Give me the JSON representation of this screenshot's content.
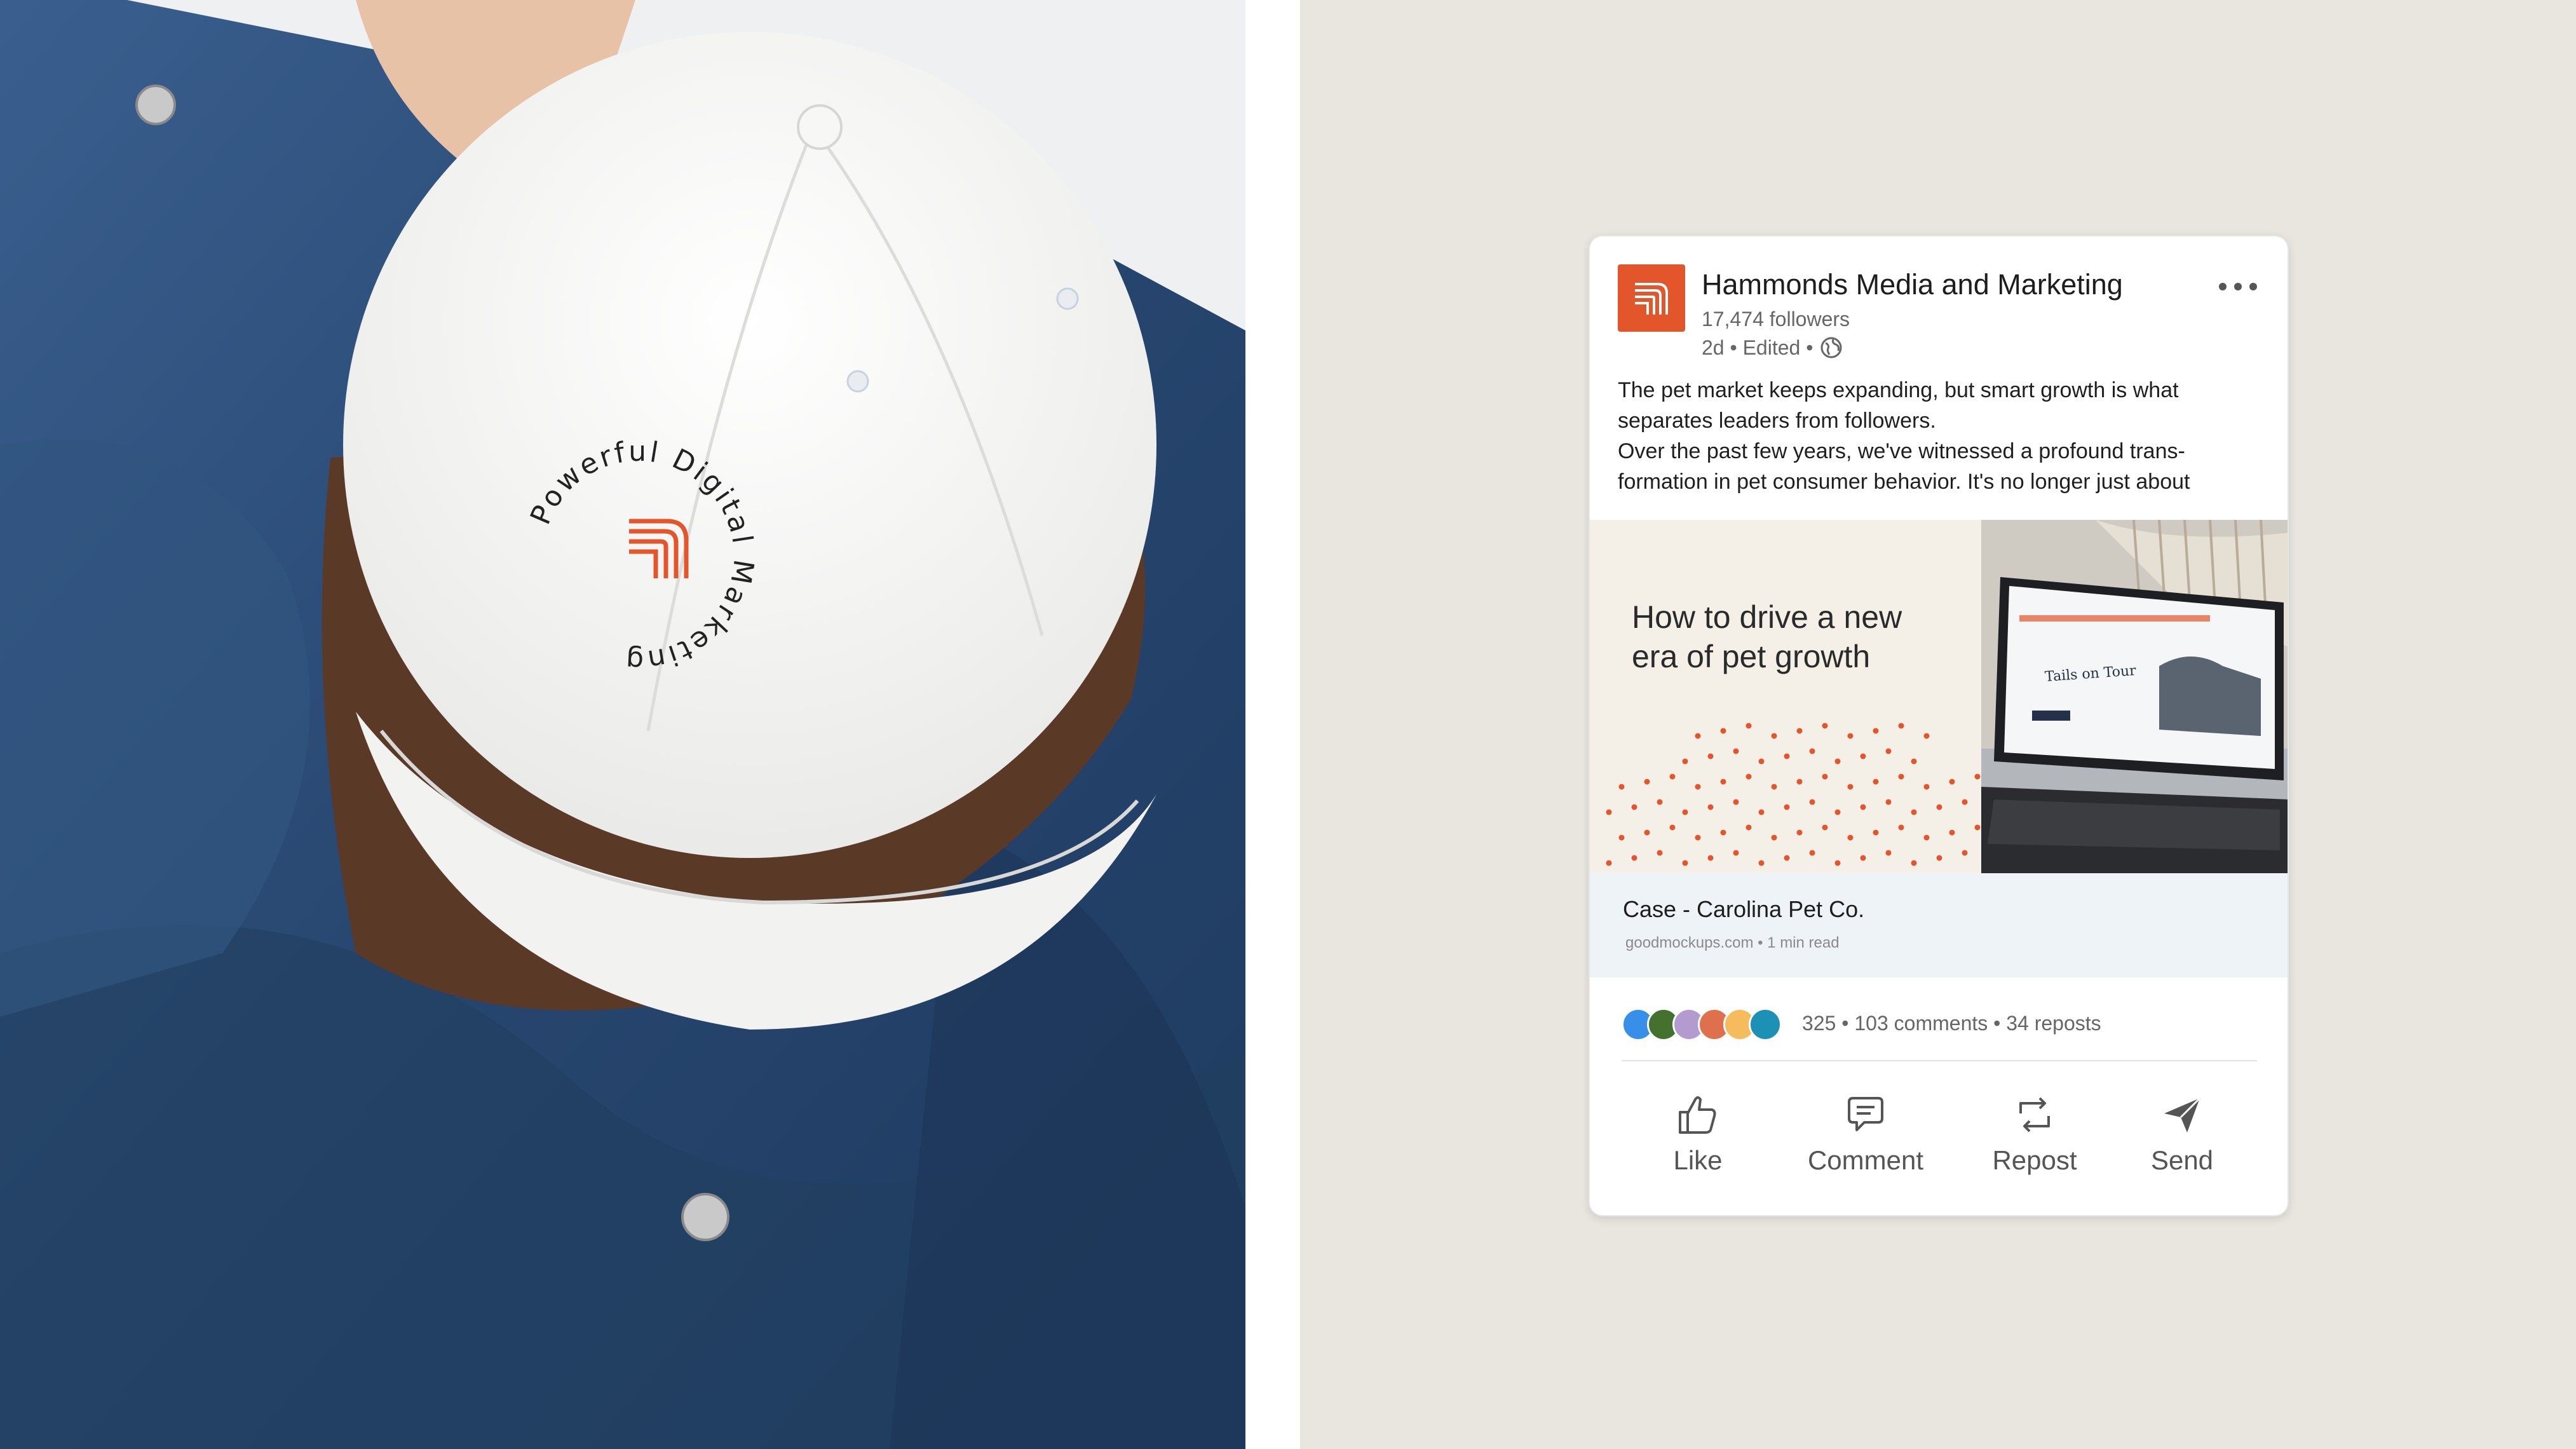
{
  "photo": {
    "cap_emblem_text": "Powerful Digital Marketing",
    "cap_icon": "stacked-arches-logo-icon"
  },
  "post": {
    "company_name": "Hammonds Media and Marketing",
    "followers": "17,474 followers",
    "meta": "2d • Edited •",
    "more_icon": "ellipsis-icon",
    "body_lines": [
      "The pet market keeps expanding, but smart growth is what",
      "separates leaders from followers.",
      "Over the past few years, we've witnessed a profound trans-",
      "formation in pet consumer behavior. It's no longer just about"
    ],
    "media": {
      "headline_line1": "How to drive a new",
      "headline_line2": "era of pet growth",
      "screen_title": "Tails on Tour"
    },
    "link": {
      "title": "Case - Carolina Pet Co.",
      "subtitle": "goodmockups.com • 1 min read"
    },
    "reactions": {
      "summary": "325 • 103 comments • 34 reposts",
      "icons": [
        "like-icon",
        "celebrate-icon",
        "support-icon",
        "love-icon",
        "insightful-icon",
        "funny-icon"
      ]
    },
    "actions": [
      {
        "label": "Like",
        "icon": "thumbs-up-icon"
      },
      {
        "label": "Comment",
        "icon": "comment-icon"
      },
      {
        "label": "Repost",
        "icon": "repost-icon"
      },
      {
        "label": "Send",
        "icon": "send-icon"
      }
    ]
  },
  "colors": {
    "brand_orange": "#e3562b",
    "panel_background": "#e9e6e0",
    "denim": "#2c4e7a"
  }
}
